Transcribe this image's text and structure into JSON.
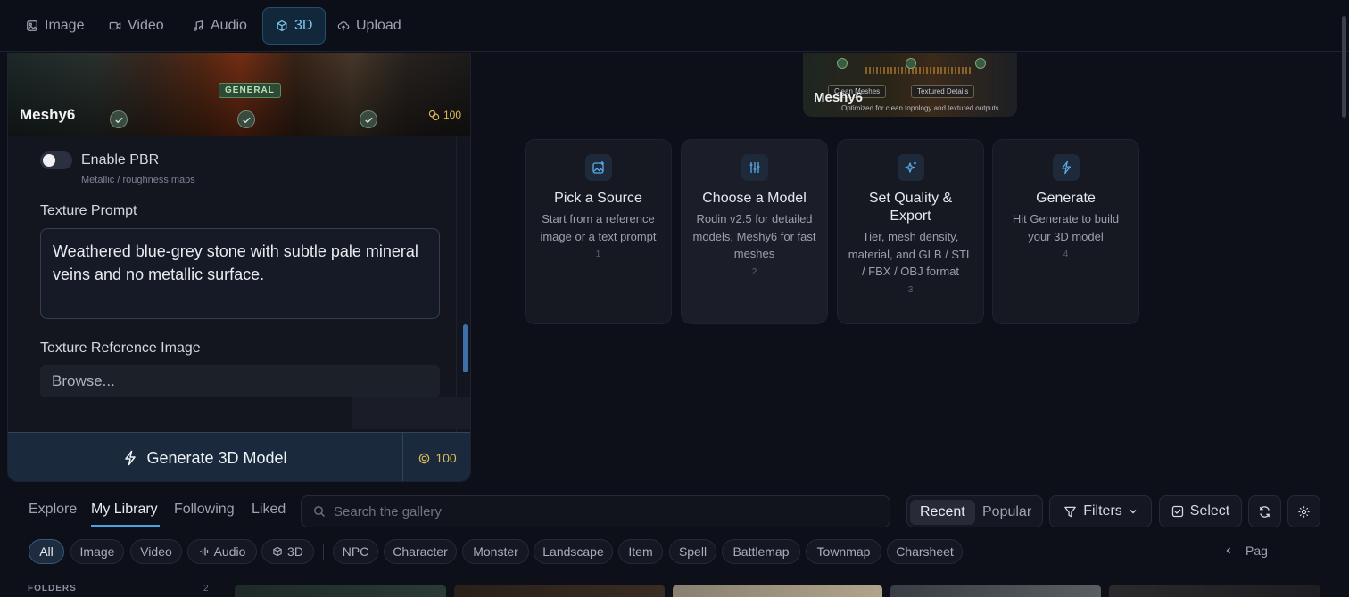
{
  "nav": {
    "tabs": [
      {
        "label": "Image",
        "icon": "image-icon"
      },
      {
        "label": "Video",
        "icon": "video-icon"
      },
      {
        "label": "Audio",
        "icon": "music-note-icon"
      },
      {
        "label": "3D",
        "icon": "cube-icon",
        "active": true
      },
      {
        "label": "Upload",
        "icon": "cloud-upload-icon"
      }
    ]
  },
  "left_panel": {
    "banner": {
      "badge": "GENERAL",
      "model_name": "Meshy6",
      "cost": "100"
    },
    "pbr": {
      "label": "Enable PBR",
      "hint": "Metallic / roughness maps",
      "enabled": false
    },
    "texture_prompt": {
      "label": "Texture Prompt",
      "value": "Weathered blue-grey stone with subtle pale mineral veins and no metallic surface."
    },
    "texture_reference": {
      "label": "Texture Reference Image",
      "placeholder": "Browse..."
    },
    "generate": {
      "label": "Generate 3D Model",
      "cost": "100"
    }
  },
  "preview": {
    "model_name": "Meshy6",
    "chips": [
      "Clean Meshes",
      "Textured Details"
    ],
    "subtitle": "Optimized for clean topology and textured outputs"
  },
  "steps": [
    {
      "title": "Pick a Source",
      "desc": "Start from a reference image or a text prompt",
      "num": "1",
      "icon": "image-plus-icon"
    },
    {
      "title": "Choose a Model",
      "desc": "Rodin v2.5 for detailed models, Meshy6 for fast meshes",
      "num": "2",
      "icon": "sliders-icon"
    },
    {
      "title": "Set Quality & Export",
      "desc": "Tier, mesh density, material, and GLB / STL / FBX / OBJ format",
      "num": "3",
      "icon": "sparkles-icon"
    },
    {
      "title": "Generate",
      "desc": "Hit Generate to build your 3D model",
      "num": "4",
      "icon": "lightning-icon"
    }
  ],
  "gallery": {
    "tabs": [
      "Explore",
      "My Library",
      "Following",
      "Liked"
    ],
    "active_tab": "My Library",
    "search_placeholder": "Search the gallery",
    "sort": {
      "options": [
        "Recent",
        "Popular"
      ],
      "selected": "Recent"
    },
    "filters_label": "Filters",
    "select_label": "Select",
    "type_chips": [
      "All",
      "Image",
      "Video",
      "Audio",
      "3D"
    ],
    "category_chips": [
      "NPC",
      "Character",
      "Monster",
      "Landscape",
      "Item",
      "Spell",
      "Battlemap",
      "Townmap",
      "Charsheet"
    ],
    "pager_label": "Pag",
    "folders_label": "FOLDERS",
    "folders_count": "2"
  },
  "colors": {
    "accent": "#4aa3e0",
    "cost": "#e0b95a",
    "background": "#0e1019"
  }
}
